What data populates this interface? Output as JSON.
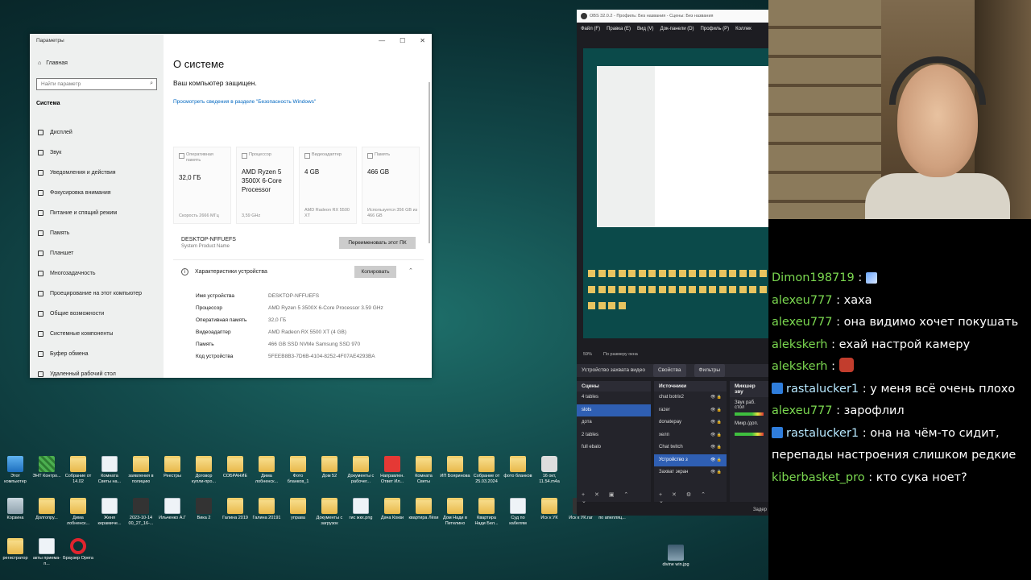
{
  "settings": {
    "window_title": "Параметры",
    "home_label": "Главная",
    "search_placeholder": "Найти параметр",
    "category": "Система",
    "nav_items": [
      "Дисплей",
      "Звук",
      "Уведомления и действия",
      "Фокусировка внимания",
      "Питание и спящий режим",
      "Память",
      "Планшет",
      "Многозадачность",
      "Проецирование на этот компьютер",
      "Общие возможности",
      "Системные компоненты",
      "Буфер обмена",
      "Удаленный рабочий стол"
    ],
    "page_title": "О системе",
    "protected_text": "Ваш компьютер защищен.",
    "security_link": "Просмотреть сведения в разделе \"Безопасность Windows\"",
    "cards": [
      {
        "label": "Оперативная память",
        "value": "32,0 ГБ",
        "sub": "Скорость 2666 МГц"
      },
      {
        "label": "Процессор",
        "value": "AMD Ryzen 5 3500X 6-Core Processor",
        "sub": "3,59 GHz"
      },
      {
        "label": "Видеоадаптер",
        "value": "4 GB",
        "sub": "AMD Radeon RX 5500 XT"
      },
      {
        "label": "Память",
        "value": "466 GB",
        "sub": "Используется 356 GB из 466 GB"
      }
    ],
    "pc_name": "DESKTOP-NFFUEFS",
    "pc_name_sub": "System Product Name",
    "rename_button": "Переименовать этот ПК",
    "specs_header": "Характеристики устройства",
    "copy_button": "Копировать",
    "specs": [
      {
        "k": "Имя устройства",
        "v": "DESKTOP-NFFUEFS"
      },
      {
        "k": "Процессор",
        "v": "AMD Ryzen 5 3500X 6-Core Processor 3.59 GHz"
      },
      {
        "k": "Оперативная память",
        "v": "32,0 ГБ"
      },
      {
        "k": "Видеоадаптер",
        "v": "AMD Radeon RX 5500 XT (4 GB)"
      },
      {
        "k": "Память",
        "v": "466 GB SSD NVMe Samsung SSD 970"
      },
      {
        "k": "Код устройства",
        "v": "5FEEB8B3-7D6B-4104-8252-4F07AE4293BA"
      }
    ]
  },
  "obs": {
    "title": "OBS 32.0.2 - Профиль: Без названия - Сцены: Без названия",
    "menu": [
      "Файл (F)",
      "Правка (E)",
      "Вид (V)",
      "Док-панели (D)",
      "Профиль (P)",
      "Коллек"
    ],
    "zoom_value": "59%",
    "zoom_mode": "По размеру окна",
    "source_name": "Устройство захвата видео",
    "properties_btn": "Свойства",
    "filters_btn": "Фильтры",
    "scenes_header": "Сцены",
    "sources_header": "Источники",
    "mixer_header": "Микшер зву",
    "scenes": [
      "4 tables",
      "slots",
      "дота",
      "2 tables",
      "full ebalo"
    ],
    "selected_scene": 1,
    "sources": [
      "chat botrix2",
      "razer",
      "donatepay",
      "хелп",
      "Chat twitch",
      "Устройство з",
      "Захват экран"
    ],
    "mixer_labels": [
      "Звук раб. стол",
      "Микр./доп."
    ],
    "status_text": "Задер"
  },
  "desktop_icons": [
    {
      "label": "Этот компьютер",
      "type": "pc"
    },
    {
      "label": "ЭНТ Контро...",
      "type": "green"
    },
    {
      "label": "Собрание от 14.02",
      "type": "folder"
    },
    {
      "label": "Комната Светы на...",
      "type": "doc"
    },
    {
      "label": "заявления в полицию",
      "type": "folder"
    },
    {
      "label": "Реестры",
      "type": "folder"
    },
    {
      "label": "Договор купли-про...",
      "type": "folder"
    },
    {
      "label": "СОБРАНИЕ",
      "type": "folder"
    },
    {
      "label": "Дима лобненск...",
      "type": "folder"
    },
    {
      "label": "Фото бланков_1",
      "type": "folder"
    },
    {
      "label": "Дом 52",
      "type": "folder"
    },
    {
      "label": "Документы с рабочег...",
      "type": "folder"
    },
    {
      "label": "Направлен. Ответ Ил...",
      "type": "pdf"
    },
    {
      "label": "Комната Светы",
      "type": "folder"
    },
    {
      "label": "ИП Бояринова",
      "type": "folder"
    },
    {
      "label": "Собрание от 25.03.2024",
      "type": "folder"
    },
    {
      "label": "фото бланков",
      "type": "folder"
    },
    {
      "label": "16 окт, 11.54.m4a",
      "type": "video"
    },
    {
      "label": "Корзина",
      "type": "bin"
    },
    {
      "label": "Долгопру...",
      "type": "folder"
    },
    {
      "label": "Дима лобненск...",
      "type": "folder"
    },
    {
      "label": "Женя керамиче...",
      "type": "doc"
    },
    {
      "label": "2023-10-14 00_27_16-...",
      "type": "dark"
    },
    {
      "label": "Ильченко А.Г",
      "type": "doc"
    },
    {
      "label": "Вика 2",
      "type": "dark"
    },
    {
      "label": "Галина 2019",
      "type": "folder"
    },
    {
      "label": "Галина 20191",
      "type": "folder"
    },
    {
      "label": "управа",
      "type": "folder"
    },
    {
      "label": "Документы с загрузок",
      "type": "folder"
    },
    {
      "label": "гис жкх.png",
      "type": "doc"
    },
    {
      "label": "Дача Кокки",
      "type": "folder"
    },
    {
      "label": "квартира Лёхи",
      "type": "folder"
    },
    {
      "label": "Дом Нади в Петелино",
      "type": "folder"
    },
    {
      "label": "Квартира Нади Бел...",
      "type": "folder"
    },
    {
      "label": "Суд по кабелям",
      "type": "doc"
    },
    {
      "label": "Иск к УК",
      "type": "folder"
    },
    {
      "label": "Иск к УК.rar",
      "type": "dark"
    },
    {
      "label": "по апелляц...",
      "type": "folder"
    },
    {
      "label": "регистратор",
      "type": "folder"
    },
    {
      "label": "акты приема-п...",
      "type": "doc"
    },
    {
      "label": "Браузер Opera",
      "type": "opera"
    },
    {
      "label": "divine win.jpg",
      "type": "img"
    }
  ],
  "chat": [
    {
      "user": "Dimon198719",
      "text": ":",
      "emote": "pen",
      "badge": false
    },
    {
      "user": "alexeu777",
      "text": ": хаха",
      "badge": false
    },
    {
      "user": "alexeu777",
      "text": ": она видимо хочет покушать",
      "badge": false
    },
    {
      "user": "alekskerh",
      "text": ": ехай настрой камеру",
      "badge": false
    },
    {
      "user": "alekskerh",
      "text": ":",
      "emote": "face",
      "badge": false
    },
    {
      "user": "rastalucker1",
      "text": ": у меня всё очень плохо",
      "badge": true
    },
    {
      "user": "alexeu777",
      "text": ": зарофлил",
      "badge": false
    },
    {
      "user": "rastalucker1",
      "text": ": она на чём-то сидит, перепады настроения слишком редкие",
      "badge": true
    },
    {
      "user": "kiberbasket_pro",
      "text": ": кто сука ноет?",
      "badge": false
    }
  ]
}
